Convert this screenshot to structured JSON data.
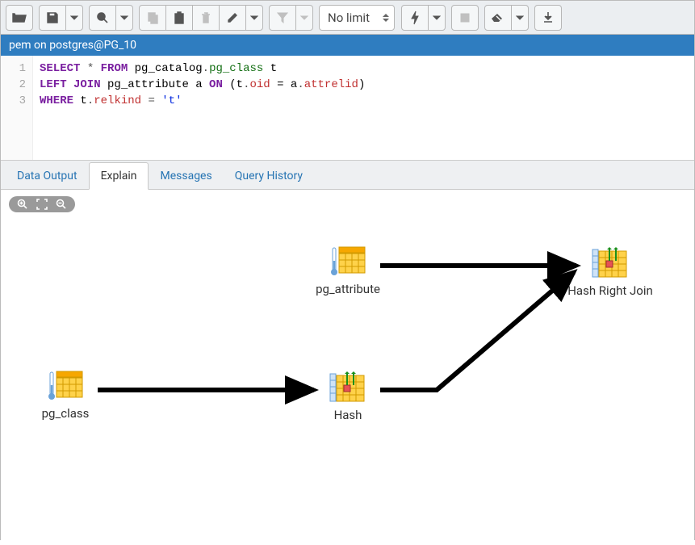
{
  "toolbar": {
    "limit_select": "No limit"
  },
  "connection": "pem on postgres@PG_10",
  "sql": {
    "lines": [
      {
        "n": 1,
        "tokens": [
          {
            "t": "SELECT",
            "c": "kw"
          },
          {
            "t": " * ",
            "c": "op"
          },
          {
            "t": "FROM",
            "c": "kw"
          },
          {
            "t": " pg_catalog",
            "c": "id"
          },
          {
            "t": ".",
            "c": "op"
          },
          {
            "t": "pg_class",
            "c": "tbl"
          },
          {
            "t": " t",
            "c": "id"
          }
        ]
      },
      {
        "n": 2,
        "tokens": [
          {
            "t": "LEFT JOIN",
            "c": "kw"
          },
          {
            "t": " pg_attribute a ",
            "c": "id"
          },
          {
            "t": "ON",
            "c": "kw"
          },
          {
            "t": " (t",
            "c": "id"
          },
          {
            "t": ".",
            "c": "op"
          },
          {
            "t": "oid",
            "c": "fn"
          },
          {
            "t": " = a",
            "c": "id"
          },
          {
            "t": ".",
            "c": "op"
          },
          {
            "t": "attrelid",
            "c": "fn"
          },
          {
            "t": ")",
            "c": "id"
          }
        ]
      },
      {
        "n": 3,
        "tokens": [
          {
            "t": "WHERE",
            "c": "kw"
          },
          {
            "t": " t",
            "c": "id"
          },
          {
            "t": ".",
            "c": "op"
          },
          {
            "t": "relkind",
            "c": "fn"
          },
          {
            "t": " = ",
            "c": "op"
          },
          {
            "t": "'t'",
            "c": "str"
          }
        ]
      }
    ]
  },
  "tabs": {
    "data_output": "Data Output",
    "explain": "Explain",
    "messages": "Messages",
    "history": "Query History",
    "active": "explain"
  },
  "explain": {
    "nodes": {
      "pg_attribute": "pg_attribute",
      "hash_right_join": "Hash Right Join",
      "pg_class": "pg_class",
      "hash": "Hash"
    }
  }
}
